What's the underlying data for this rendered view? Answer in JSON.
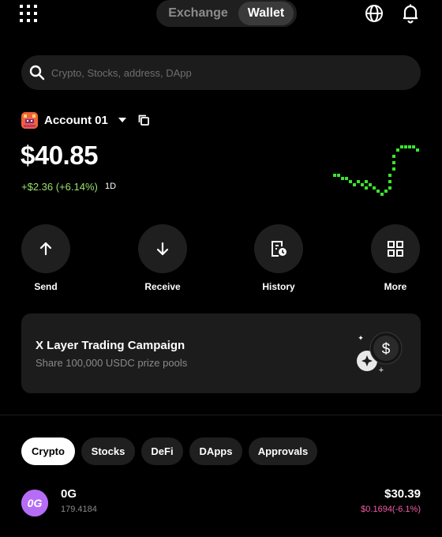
{
  "header": {
    "tabs": [
      {
        "label": "Exchange",
        "active": false
      },
      {
        "label": "Wallet",
        "active": true
      }
    ],
    "icons": [
      "apps-grid-icon",
      "globe-icon",
      "bell-icon"
    ]
  },
  "search": {
    "placeholder": "Crypto, Stocks, address, DApp",
    "value": ""
  },
  "account": {
    "name": "Account 01",
    "balance": "$40.85",
    "change": "+$2.36 (+6.14%)",
    "period": "1D",
    "change_color": "#9be26b",
    "sparkline_color": "#39e62b"
  },
  "actions": [
    {
      "label": "Send",
      "icon": "arrow-up-icon"
    },
    {
      "label": "Receive",
      "icon": "arrow-down-icon"
    },
    {
      "label": "History",
      "icon": "history-icon"
    },
    {
      "label": "More",
      "icon": "grid-more-icon"
    }
  ],
  "banner": {
    "title": "X Layer Trading Campaign",
    "subtitle": "Share 100,000 USDC prize pools"
  },
  "asset_tabs": [
    {
      "label": "Crypto",
      "active": true
    },
    {
      "label": "Stocks",
      "active": false
    },
    {
      "label": "DeFi",
      "active": false
    },
    {
      "label": "DApps",
      "active": false
    },
    {
      "label": "Approvals",
      "active": false
    }
  ],
  "assets": [
    {
      "symbol": "0G",
      "logo_text": "0G",
      "amount": "179.4184",
      "value": "$30.39",
      "change": "$0.1694(-6.1%)",
      "change_color": "#f05ea8",
      "logo_color": "#b56cf6"
    }
  ]
}
